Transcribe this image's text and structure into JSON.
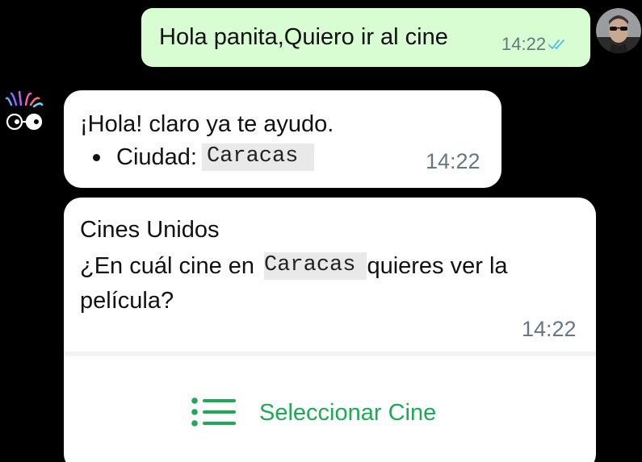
{
  "chat": {
    "outgoing": {
      "text": "Hola panita,Quiero ir al cine",
      "time": "14:22",
      "status_icon": "double-check-icon"
    },
    "incoming_1": {
      "line1": "¡Hola! claro ya te ayudo.",
      "bullet_label": "Ciudad:",
      "bullet_value": "Caracas",
      "time": "14:22"
    },
    "incoming_2": {
      "title": "Cines Unidos",
      "line_prefix": "¿En cuál cine en",
      "line_code": "Caracas",
      "line_suffix": "quieres ver la",
      "line2": "película?",
      "time": "14:22",
      "button": {
        "icon": "list-icon",
        "label": "Seleccionar Cine"
      }
    }
  },
  "colors": {
    "background": "#000000",
    "outgoing_bubble": "#d9fdd3",
    "incoming_bubble": "#ffffff",
    "accent_green": "#1fa855",
    "read_tick": "#53bdeb",
    "timestamp": "#667781"
  }
}
